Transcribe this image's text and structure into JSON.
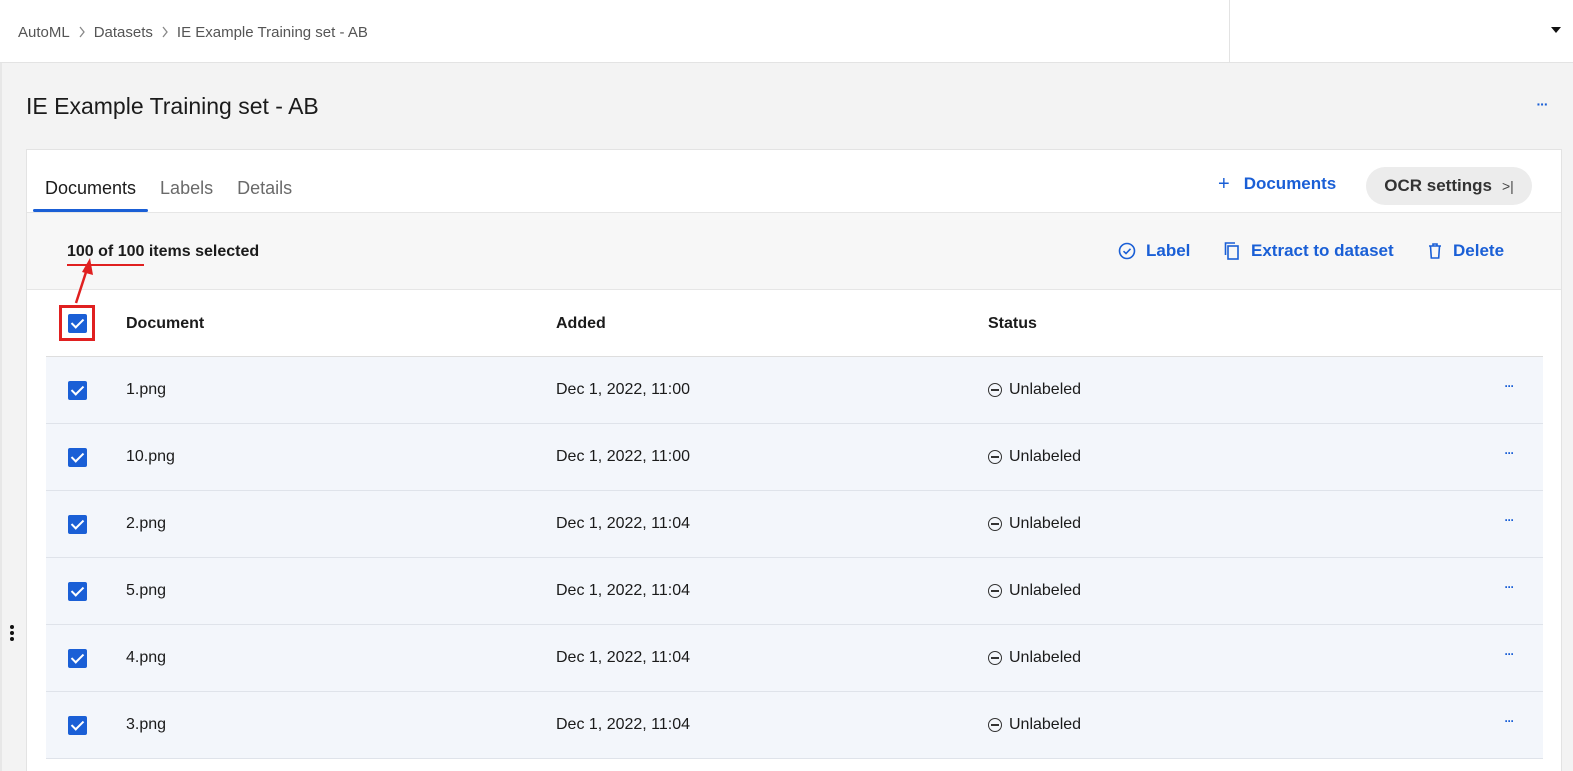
{
  "breadcrumb": {
    "items": [
      "AutoML",
      "Datasets",
      "IE Example Training set - AB"
    ]
  },
  "page": {
    "title": "IE Example Training set - AB",
    "more_label": "···"
  },
  "tabs": [
    {
      "label": "Documents",
      "active": true
    },
    {
      "label": "Labels",
      "active": false
    },
    {
      "label": "Details",
      "active": false
    }
  ],
  "header_actions": {
    "add_documents_label": "Documents",
    "ocr_settings_label": "OCR settings",
    "ocr_arrow": ">|"
  },
  "selection": {
    "count_text": "100 of 100",
    "suffix": "items selected"
  },
  "actions": {
    "label": "Label",
    "extract": "Extract to dataset",
    "delete": "Delete"
  },
  "table": {
    "columns": [
      "Document",
      "Added",
      "Status"
    ],
    "rows": [
      {
        "document": "1.png",
        "added": "Dec 1, 2022, 11:00",
        "status": "Unlabeled",
        "checked": true
      },
      {
        "document": "10.png",
        "added": "Dec 1, 2022, 11:00",
        "status": "Unlabeled",
        "checked": true
      },
      {
        "document": "2.png",
        "added": "Dec 1, 2022, 11:04",
        "status": "Unlabeled",
        "checked": true
      },
      {
        "document": "5.png",
        "added": "Dec 1, 2022, 11:04",
        "status": "Unlabeled",
        "checked": true
      },
      {
        "document": "4.png",
        "added": "Dec 1, 2022, 11:04",
        "status": "Unlabeled",
        "checked": true
      },
      {
        "document": "3.png",
        "added": "Dec 1, 2022, 11:04",
        "status": "Unlabeled",
        "checked": true
      }
    ],
    "row_more_label": "···"
  },
  "colors": {
    "accent": "#1a5fd6",
    "annotation": "#e02020"
  }
}
